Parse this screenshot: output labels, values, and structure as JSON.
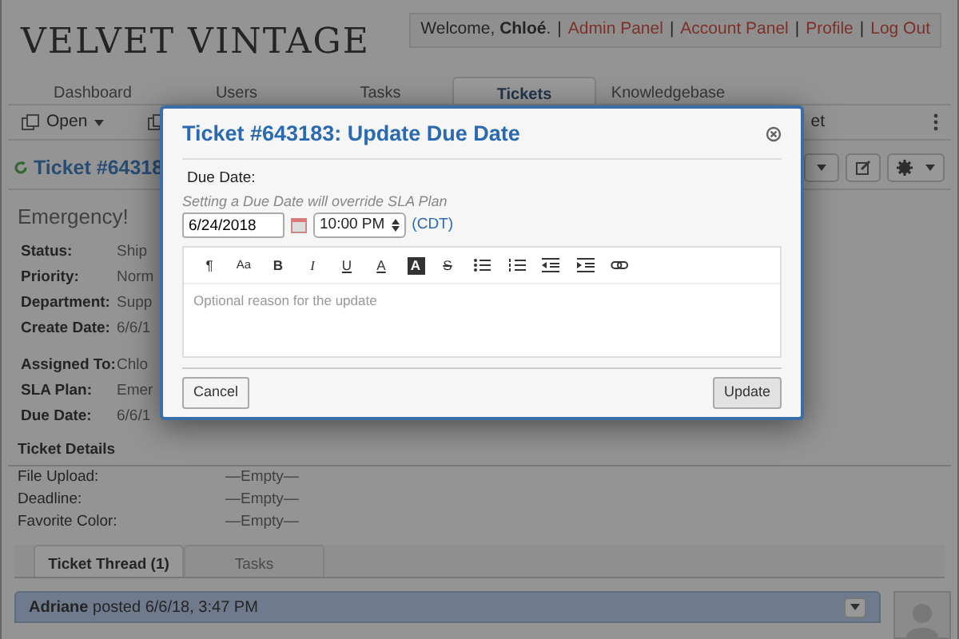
{
  "header": {
    "logo": "VELVET VINTAGE",
    "welcome": "Welcome, **Chloé**.",
    "links": [
      "Admin Panel",
      "Account Panel",
      "Profile",
      "Log Out"
    ],
    "separators": [
      "|",
      "|",
      "|",
      "|"
    ]
  },
  "nav_tabs": [
    {
      "label": "Dashboard",
      "selected": false
    },
    {
      "label": "Users",
      "selected": false
    },
    {
      "label": "Tasks",
      "selected": false
    },
    {
      "label": "Tickets",
      "selected": true
    },
    {
      "label": "Knowledgebase",
      "selected": false
    }
  ],
  "toolbar": {
    "open_button": "Open",
    "partial_label": "et"
  },
  "ticket": {
    "title": "Ticket #64318",
    "subject": "Emergency!",
    "fields": [
      {
        "label": "Status:",
        "value": "Ship"
      },
      {
        "label": "Priority:",
        "value": "Norm"
      },
      {
        "label": "Department:",
        "value": "Supp"
      },
      {
        "label": "Create Date:",
        "value": "6/6/1"
      }
    ],
    "assignment": [
      {
        "label": "Assigned To:",
        "value": "Chlo"
      },
      {
        "label": "SLA Plan:",
        "value": "Emer"
      },
      {
        "label": "Due Date:",
        "value": "6/6/1"
      }
    ]
  },
  "details": {
    "title": "Ticket Details",
    "fields": [
      {
        "label": "File Upload:",
        "value": "—Empty—"
      },
      {
        "label": "Deadline:",
        "value": "—Empty—"
      },
      {
        "label": "Favorite Color:",
        "value": "—Empty—"
      }
    ]
  },
  "thread_tabs": [
    {
      "label": "Ticket Thread (1)",
      "selected": true
    },
    {
      "label": "Tasks",
      "selected": false
    }
  ],
  "post": {
    "header": "**Adriane** posted 6/6/18, 3:47 PM"
  },
  "modal": {
    "title": "Ticket #643183: Update Due Date",
    "field_label": "Due Date:",
    "hint": "Setting a Due Date will override SLA Plan",
    "date": "6/24/2018",
    "time": "10:00 PM",
    "timezone": "(CDT)",
    "editor_tools": [
      {
        "kind": "plain",
        "label": "¶"
      },
      {
        "kind": "small",
        "label": "Aa"
      },
      {
        "kind": "bold",
        "label": "B"
      },
      {
        "kind": "italic",
        "label": "I"
      },
      {
        "kind": "underline",
        "label": "U"
      },
      {
        "kind": "color",
        "label": "A"
      },
      {
        "kind": "highlight",
        "label": "A"
      },
      {
        "kind": "strike",
        "label": "S"
      },
      {
        "kind": "bullets"
      },
      {
        "kind": "numbers"
      },
      {
        "kind": "outdent"
      },
      {
        "kind": "indent"
      },
      {
        "kind": "link"
      }
    ],
    "placeholder": "Optional reason for the update",
    "buttons": [
      "Cancel",
      "Update"
    ]
  }
}
